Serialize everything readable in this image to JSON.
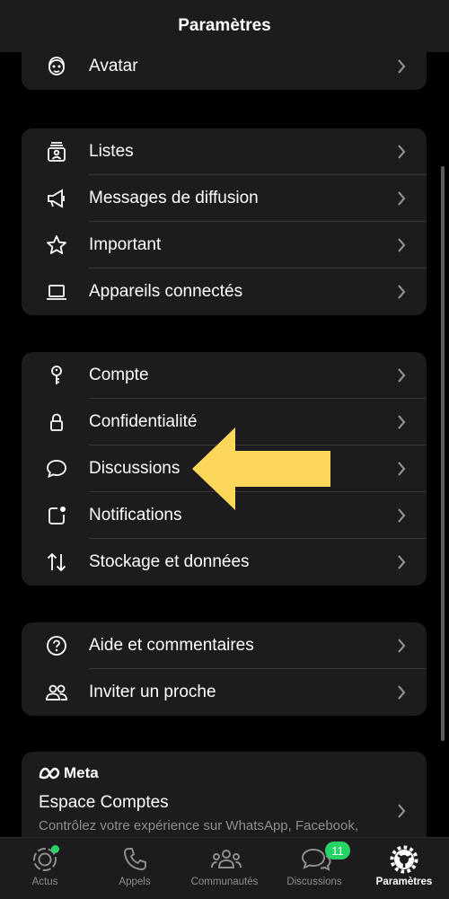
{
  "header": {
    "title": "Paramètres"
  },
  "groups": [
    {
      "items": [
        {
          "label": "Avatar",
          "icon": "avatar-icon"
        }
      ]
    },
    {
      "items": [
        {
          "label": "Listes",
          "icon": "lists-icon"
        },
        {
          "label": "Messages de diffusion",
          "icon": "megaphone-icon"
        },
        {
          "label": "Important",
          "icon": "star-icon"
        },
        {
          "label": "Appareils connectés",
          "icon": "laptop-icon"
        }
      ]
    },
    {
      "items": [
        {
          "label": "Compte",
          "icon": "key-icon"
        },
        {
          "label": "Confidentialité",
          "icon": "lock-icon"
        },
        {
          "label": "Discussions",
          "icon": "chat-bubble-icon"
        },
        {
          "label": "Notifications",
          "icon": "notification-icon"
        },
        {
          "label": "Stockage et données",
          "icon": "storage-arrows-icon"
        }
      ]
    },
    {
      "items": [
        {
          "label": "Aide et commentaires",
          "icon": "help-icon"
        },
        {
          "label": "Inviter un proche",
          "icon": "invite-people-icon"
        }
      ]
    }
  ],
  "meta": {
    "brand": "Meta",
    "title": "Espace Comptes",
    "subtitle": "Contrôlez votre expérience sur WhatsApp, Facebook,"
  },
  "tabbar": {
    "tabs": [
      {
        "label": "Actus",
        "icon": "status-icon"
      },
      {
        "label": "Appels",
        "icon": "phone-icon"
      },
      {
        "label": "Communautés",
        "icon": "communities-icon"
      },
      {
        "label": "Discussions",
        "icon": "chats-icon",
        "badge": "11"
      },
      {
        "label": "Paramètres",
        "icon": "settings-icon"
      }
    ],
    "active": "Paramètres"
  },
  "colors": {
    "accent": "#25d366",
    "arrow": "#fcd75a",
    "background": "#000000",
    "card": "#1c1c1e"
  }
}
